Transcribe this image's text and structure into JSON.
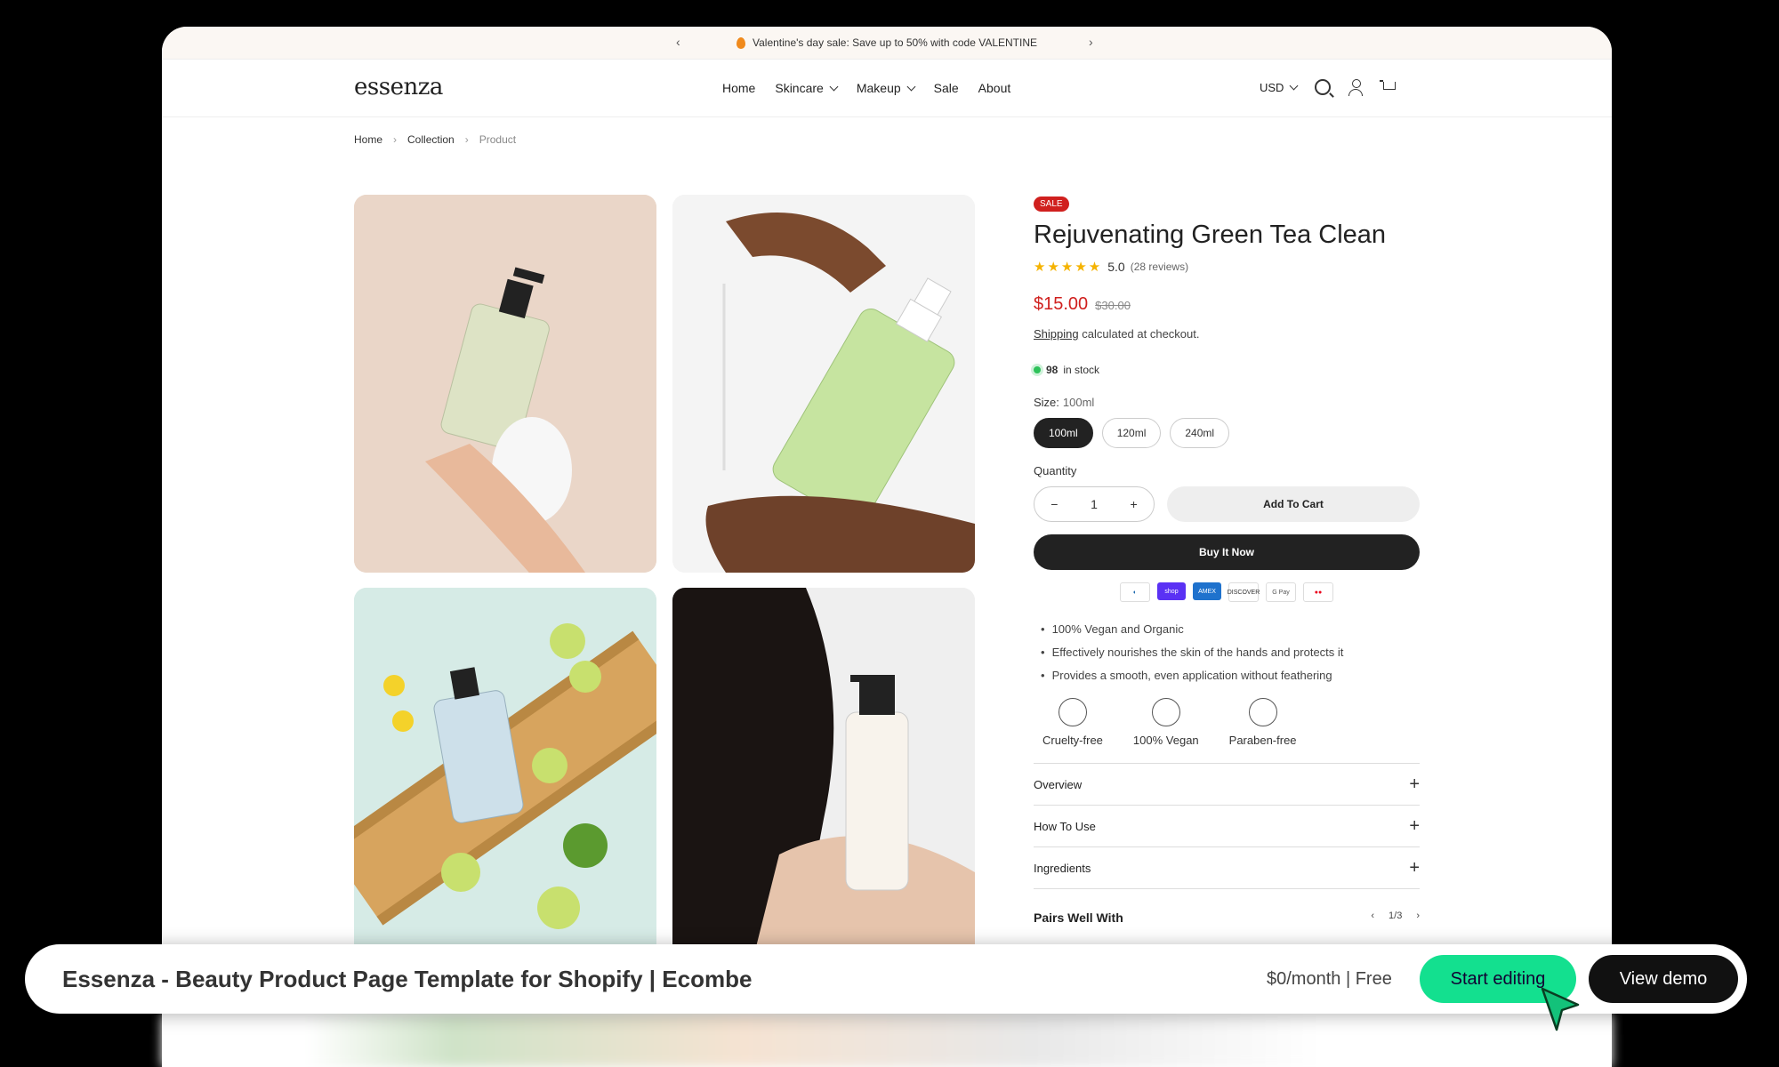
{
  "announcement": {
    "text": "Valentine's day sale: Save up to 50% with code VALENTINE"
  },
  "header": {
    "logo": "essenza",
    "nav": [
      {
        "label": "Home"
      },
      {
        "label": "Skincare"
      },
      {
        "label": "Makeup"
      },
      {
        "label": "Sale"
      },
      {
        "label": "About"
      }
    ],
    "currency": "USD"
  },
  "breadcrumb": [
    "Home",
    "Collection",
    "Product"
  ],
  "product": {
    "badge": "SALE",
    "title": "Rejuvenating Green Tea Clean",
    "rating": "5.0",
    "reviews": "(28 reviews)",
    "price": "$15.00",
    "old_price": "$30.00",
    "shipping_link": "Shipping",
    "shipping_text": "calculated at checkout.",
    "stock_count": "98",
    "stock_text": "in stock",
    "size_label": "Size:",
    "size_value": "100ml",
    "sizes": [
      "100ml",
      "120ml",
      "240ml"
    ],
    "quantity_label": "Quantity",
    "quantity": "1",
    "add_to_cart": "Add To Cart",
    "buy_now": "Buy It Now",
    "payments": [
      "Diners",
      "shop",
      "AMEX",
      "DISCOVER",
      "G Pay",
      "Mastercard"
    ],
    "bullets": [
      "100% Vegan and Organic",
      "Effectively nourishes the skin of the hands and protects it",
      "Provides a smooth, even application without feathering"
    ],
    "features": [
      "Cruelty-free",
      "100% Vegan",
      "Paraben-free"
    ],
    "accordion": [
      "Overview",
      "How To Use",
      "Ingredients"
    ],
    "pairs_title": "Pairs Well With",
    "pairs_page": "1/3"
  },
  "banner": {
    "title": "Essenza - Beauty Product Page Template for Shopify | Ecombe",
    "price": "$0/month | Free",
    "start": "Start editing",
    "demo": "View demo"
  },
  "colors": {
    "accent": "#13e08f",
    "sale": "#d0201e",
    "dark": "#222222"
  }
}
